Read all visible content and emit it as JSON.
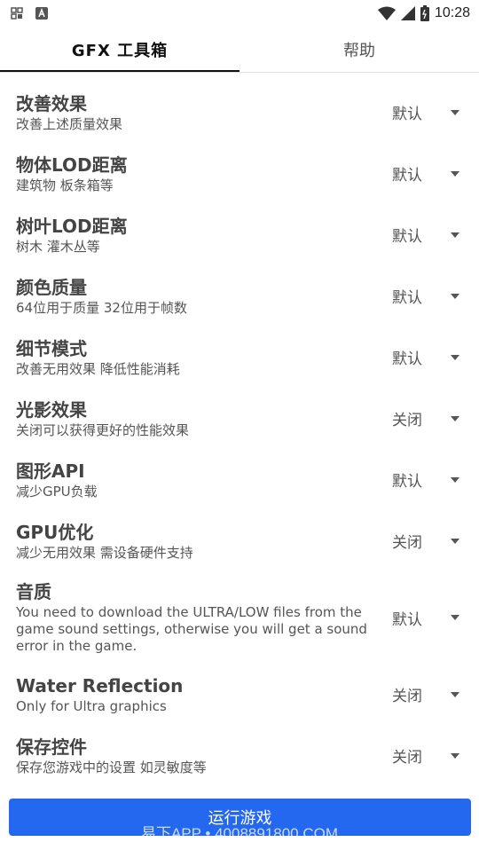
{
  "status_bar": {
    "time": "10:28"
  },
  "tabs": [
    {
      "label": "GFX 工具箱"
    },
    {
      "label": "帮助"
    }
  ],
  "settings": [
    {
      "title": "改善效果",
      "subtitle": "改善上述质量效果",
      "value": "默认"
    },
    {
      "title": "物体LOD距离",
      "subtitle": "建筑物 板条箱等",
      "value": "默认"
    },
    {
      "title": "树叶LOD距离",
      "subtitle": "树木 灌木丛等",
      "value": "默认"
    },
    {
      "title": "颜色质量",
      "subtitle": "64位用于质量 32位用于帧数",
      "value": "默认"
    },
    {
      "title": "细节模式",
      "subtitle": "改善无用效果 降低性能消耗",
      "value": "默认"
    },
    {
      "title": "光影效果",
      "subtitle": "关闭可以获得更好的性能效果",
      "value": "关闭"
    },
    {
      "title": "图形API",
      "subtitle": "减少GPU负载",
      "value": "默认"
    },
    {
      "title": "GPU优化",
      "subtitle": "减少无用效果 需设备硬件支持",
      "value": "关闭"
    },
    {
      "title": "音质",
      "subtitle": "You need to download the ULTRA/LOW files from the game sound settings, otherwise you will get a sound error in the game.",
      "value": "默认"
    },
    {
      "title": "Water Reflection",
      "subtitle": "Only for Ultra graphics",
      "value": "关闭"
    },
    {
      "title": "保存控件",
      "subtitle": "保存您游戏中的设置 如灵敏度等",
      "value": "关闭"
    }
  ],
  "run_button": {
    "label": "运行游戏"
  },
  "watermark": "易下APP • 4008891800.COM",
  "colors": {
    "accent": "#2568f0"
  }
}
